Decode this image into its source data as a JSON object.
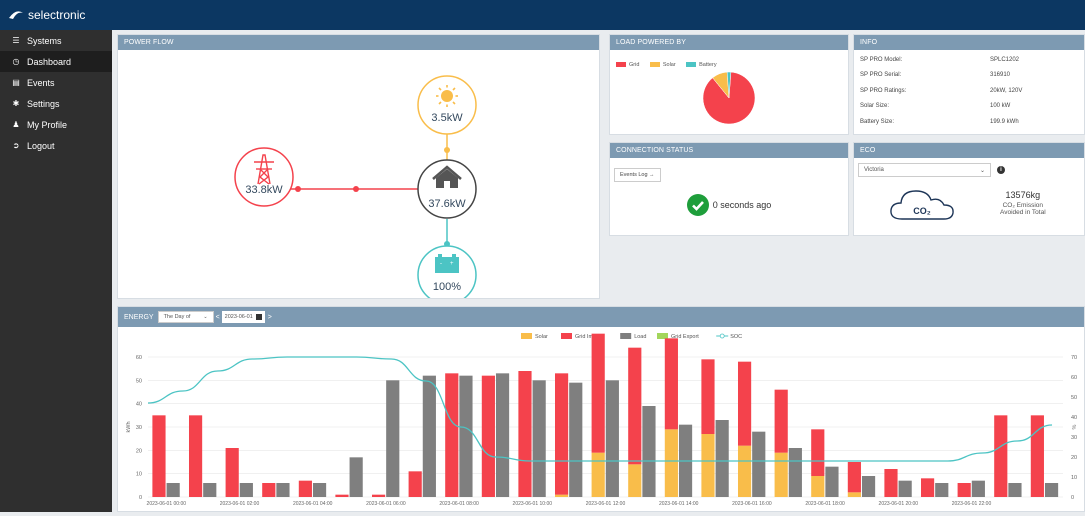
{
  "brand": {
    "name": "selectronic"
  },
  "sidebar": {
    "items": [
      {
        "label": "Systems",
        "icon": "list-icon"
      },
      {
        "label": "Dashboard",
        "icon": "dashboard-icon"
      },
      {
        "label": "Events",
        "icon": "events-icon"
      },
      {
        "label": "Settings",
        "icon": "gear-icon"
      },
      {
        "label": "My Profile",
        "icon": "user-icon"
      },
      {
        "label": "Logout",
        "icon": "logout-icon"
      }
    ],
    "active": "Dashboard"
  },
  "power_flow": {
    "title": "POWER FLOW",
    "solar": "3.5kW",
    "grid": "33.8kW",
    "load": "37.6kW",
    "battery": "100%"
  },
  "load_powered_by": {
    "title": "LOAD POWERED BY",
    "legend": [
      "Grid",
      "Solar",
      "Battery"
    ],
    "colors": {
      "Grid": "#f4424c",
      "Solar": "#f9bd4a",
      "Battery": "#4cc4c4"
    },
    "fractions": {
      "Grid": 0.88,
      "Solar": 0.097,
      "Battery": 0.023
    }
  },
  "info": {
    "title": "INFO",
    "rows": [
      {
        "k": "SP PRO Model:",
        "v": "SPLC1202"
      },
      {
        "k": "SP PRO Serial:",
        "v": "316910"
      },
      {
        "k": "SP PRO Ratings:",
        "v": "20kW, 120V"
      },
      {
        "k": "Solar Size:",
        "v": "100 kW"
      },
      {
        "k": "Battery Size:",
        "v": "199.9 kWh"
      }
    ]
  },
  "connection": {
    "title": "CONNECTION STATUS",
    "events_btn": "Events Log →",
    "status": "0 seconds ago"
  },
  "eco": {
    "title": "ECO",
    "region": "Victoria",
    "co2_value": "13576kg",
    "co2_line1": "CO₂ Emission",
    "co2_line2": "Avoided in Total",
    "cloud_text": "CO₂"
  },
  "energy": {
    "title": "ENERGY",
    "period": "The Day of",
    "date": "2023-06-01",
    "prev": "<",
    "next": ">"
  },
  "chart_data": {
    "type": "bar",
    "legend": [
      "Solar",
      "Grid Import",
      "Load",
      "Grid Export",
      "SOC"
    ],
    "colors": {
      "Solar": "#f9bd4a",
      "Grid Import": "#f4424c",
      "Load": "#7f7f7f",
      "Grid Export": "#a3d65c",
      "SOC": "#4cc4c4"
    },
    "ylabel": "kWh",
    "y2label": "%",
    "ylim": [
      0,
      60
    ],
    "y2lim": [
      0,
      70
    ],
    "yticks": [
      0,
      10,
      20,
      30,
      40,
      50,
      60
    ],
    "y2ticks": [
      0,
      10,
      20,
      30,
      40,
      50,
      60,
      70
    ],
    "x_labels": [
      "2023-06-01 00:00",
      "2023-06-01 02:00",
      "2023-06-01 04:00",
      "2023-06-01 06:00",
      "2023-06-01 08:00",
      "2023-06-01 10:00",
      "2023-06-01 12:00",
      "2023-06-01 14:00",
      "2023-06-01 16:00",
      "2023-06-01 18:00",
      "2023-06-01 20:00",
      "2023-06-01 22:00"
    ],
    "solar": [
      0,
      0,
      0,
      0,
      0,
      0,
      0,
      0,
      0,
      0,
      0,
      1,
      19,
      14,
      29,
      27,
      22,
      19,
      9,
      2,
      0,
      0,
      0,
      0,
      0,
      0,
      0,
      0
    ],
    "grid_import": [
      35,
      35,
      21,
      6,
      7,
      1,
      1,
      11,
      53,
      52,
      54,
      52,
      51,
      50,
      39,
      32,
      36,
      27,
      20,
      13,
      12,
      8,
      6,
      35,
      35
    ],
    "load": [
      6,
      6,
      6,
      6,
      6,
      17,
      50,
      52,
      52,
      53,
      50,
      49,
      50,
      39,
      31,
      33,
      28,
      21,
      13,
      9,
      7,
      6,
      7,
      6,
      6
    ],
    "soc": [
      47,
      53,
      63,
      69,
      70,
      70,
      70,
      69,
      58,
      35,
      20,
      18,
      18,
      18,
      18,
      18,
      18,
      18,
      18,
      18,
      18,
      18,
      18,
      18,
      22,
      28,
      36
    ]
  }
}
